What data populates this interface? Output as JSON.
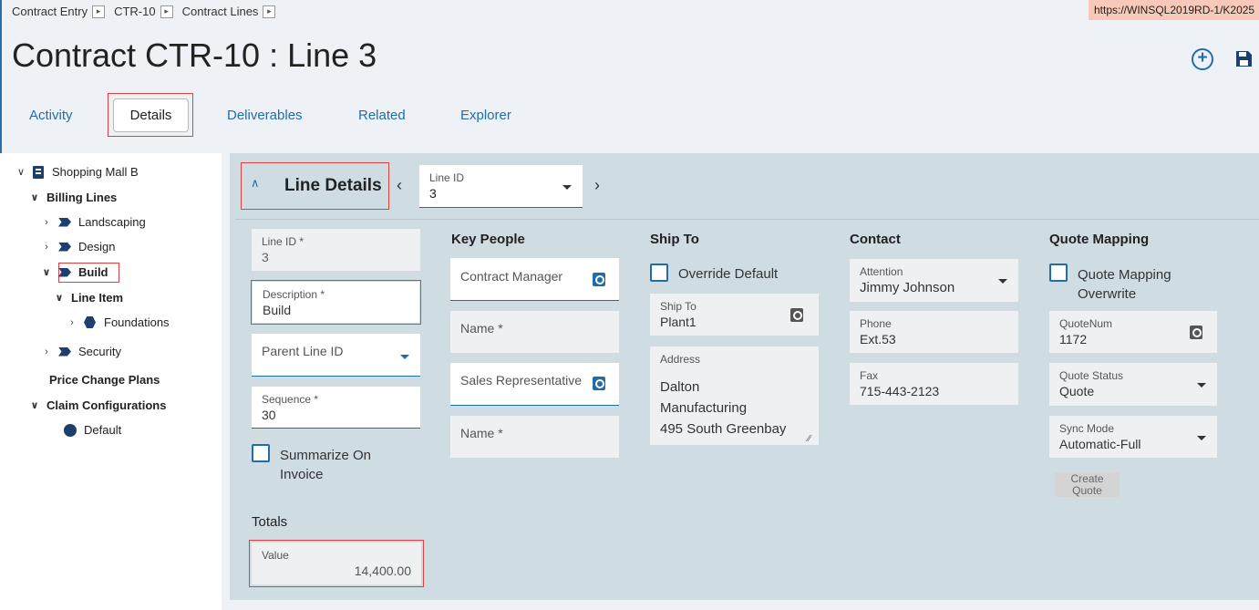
{
  "breadcrumb": [
    "Contract Entry",
    "CTR-10",
    "Contract Lines"
  ],
  "url": "https://WINSQL2019RD-1/K2025",
  "page": {
    "title": "Contract CTR-10 : Line 3"
  },
  "tabs": [
    "Activity",
    "Details",
    "Deliverables",
    "Related",
    "Explorer"
  ],
  "active_tab": "Details",
  "tree": {
    "root": "Shopping Mall B",
    "billing_lines": "Billing Lines",
    "landscaping": "Landscaping",
    "design": "Design",
    "build": "Build",
    "line_item": "Line Item",
    "foundations": "Foundations",
    "security": "Security",
    "price_change_plans": "Price Change Plans",
    "claim_configurations": "Claim Configurations",
    "default": "Default"
  },
  "panel": {
    "title": "Line Details",
    "line_id_label": "Line ID",
    "line_id_value": "3"
  },
  "line": {
    "line_id_label": "Line ID *",
    "line_id_value": "3",
    "description_label": "Description *",
    "description_value": "Build",
    "parent_label": "Parent Line ID",
    "sequence_label": "Sequence *",
    "sequence_value": "30",
    "summarize_label_1": "Summarize On",
    "summarize_label_2": "Invoice",
    "totals_label": "Totals",
    "value_label": "Value",
    "value_value": "14,400.00"
  },
  "key_people": {
    "heading": "Key People",
    "contract_manager": "Contract Manager",
    "name1": "Name *",
    "sales_rep": "Sales Representative",
    "name2": "Name *"
  },
  "ship_to": {
    "heading": "Ship To",
    "override": "Override Default",
    "ship_to_label": "Ship To",
    "ship_to_value": "Plant1",
    "address_label": "Address",
    "address_line1": "Dalton",
    "address_line2": "Manufacturing",
    "address_line3": "495 South Greenbay"
  },
  "contact": {
    "heading": "Contact",
    "attention_label": "Attention",
    "attention_value": "Jimmy Johnson",
    "phone_label": "Phone",
    "phone_value": "Ext.53",
    "fax_label": "Fax",
    "fax_value": "715-443-2123"
  },
  "quote": {
    "heading": "Quote Mapping",
    "overwrite_1": "Quote Mapping",
    "overwrite_2": "Overwrite",
    "quotenum_label": "QuoteNum",
    "quotenum_value": "1172",
    "status_label": "Quote Status",
    "status_value": "Quote",
    "sync_label": "Sync Mode",
    "sync_value": "Automatic-Full",
    "create_1": "Create",
    "create_2": "Quote"
  },
  "colors": {
    "accent": "#1f6dab",
    "highlight": "#e04040",
    "panel": "#cfdde3"
  }
}
